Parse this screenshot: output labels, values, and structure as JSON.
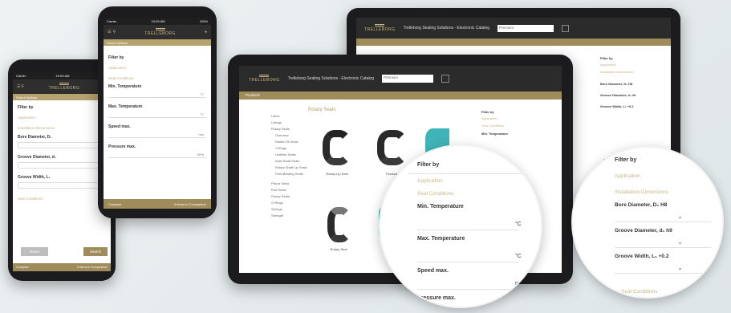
{
  "brand": {
    "name": "TRELLEBORG",
    "accent": "#a08c5b",
    "dark": "#2b2b2b"
  },
  "header": {
    "title": "Trelleborg Sealing Solutions - Electronic Catalog",
    "search_value": "Premium"
  },
  "phone_left": {
    "status": {
      "carrier": "Carrier",
      "time": "10:09 AM",
      "battery": "100%"
    },
    "strip": "Select Options",
    "filter_title": "Filter by",
    "section_application": "Application",
    "section_installation": "Installation Dimensions",
    "fields": [
      {
        "label": "Bore Diameter, D₀",
        "value": ""
      },
      {
        "label": "Groove Diameter, d₁",
        "value": ""
      },
      {
        "label": "Groove Width, L₁",
        "value": ""
      }
    ],
    "section_service": "Seal Conditions",
    "reset_label": "Reset",
    "search_label": "Search",
    "footer_left": "Compare",
    "footer_right": "0 Items in Comparison"
  },
  "phone_right": {
    "status": {
      "carrier": "Carrier",
      "time": "10:09 AM",
      "battery": "100%"
    },
    "strip": "Select Options",
    "filter_title": "Filter by",
    "section_application": "Application",
    "section_service": "Seal Conditions",
    "fields": [
      {
        "label": "Min. Temperature",
        "unit": "°C"
      },
      {
        "label": "Max. Temperature",
        "unit": "°C"
      },
      {
        "label": "Speed max.",
        "unit": "m/s"
      },
      {
        "label": "Pressure max.",
        "unit": "MPa"
      }
    ],
    "footer_left": "Compare",
    "footer_right": "0 Items in Comparison"
  },
  "tablet_front": {
    "breadcrumb": "Products",
    "section_title": "Rotary Seals",
    "sidebar": [
      {
        "label": "Home",
        "sub": false
      },
      {
        "label": "Linings",
        "sub": false
      },
      {
        "label": "Rotary Seals",
        "sub": false
      },
      {
        "label": "Overview",
        "sub": true
      },
      {
        "label": "Radial Oil Seals",
        "sub": true
      },
      {
        "label": "V-Rings",
        "sub": true
      },
      {
        "label": "Unitized Seals",
        "sub": true
      },
      {
        "label": "Axial Shaft Seals",
        "sub": true
      },
      {
        "label": "Rotary Shaft Lip Seals",
        "sub": true
      },
      {
        "label": "Field Bearing Seals",
        "sub": true
      },
      {
        "label": "Piston Seals",
        "sub": false
      },
      {
        "label": "Rod Seals",
        "sub": false
      },
      {
        "label": "Rotary Seals",
        "sub": false
      },
      {
        "label": "O-Rings",
        "sub": false
      },
      {
        "label": "Springs",
        "sub": false
      },
      {
        "label": "Strength",
        "sub": false
      }
    ],
    "products": [
      {
        "name": "Rotary Lip Seal"
      },
      {
        "name": "Product"
      },
      {
        "name": "Rotary Seal"
      },
      {
        "name": "Product"
      }
    ],
    "filter_title": "Filter by",
    "filter_items": [
      "Application",
      "Seal Conditions",
      "Min. Temperature"
    ]
  },
  "tablet_back": {
    "filter_title": "Filter by",
    "filter_items": [
      "Application",
      "Installation Dimensions",
      "Bore Diameter, D₀ H8",
      "Groove Diameter, d₁ h9",
      "Groove Width, L₁ +0.2"
    ]
  },
  "zoom_left": {
    "filter_title": "Filter by",
    "section_application": "Application",
    "section_service": "Seal Conditions",
    "fields": [
      {
        "label": "Min. Temperature",
        "unit": "°C"
      },
      {
        "label": "Max. Temperature",
        "unit": "°C"
      },
      {
        "label": "Speed max.",
        "unit": "m/s"
      },
      {
        "label": "Pressure max.",
        "unit": ""
      }
    ]
  },
  "zoom_right": {
    "filter_title": "Filter by",
    "section_application": "Application",
    "section_installation": "Installation Dimensions",
    "fields": [
      {
        "label": "Bore Diameter, D₀ H8"
      },
      {
        "label": "Groove Diameter, d₁ h9"
      },
      {
        "label": "Groove Width, L₁ +0.2"
      }
    ],
    "section_service": "Seal Conditions"
  }
}
